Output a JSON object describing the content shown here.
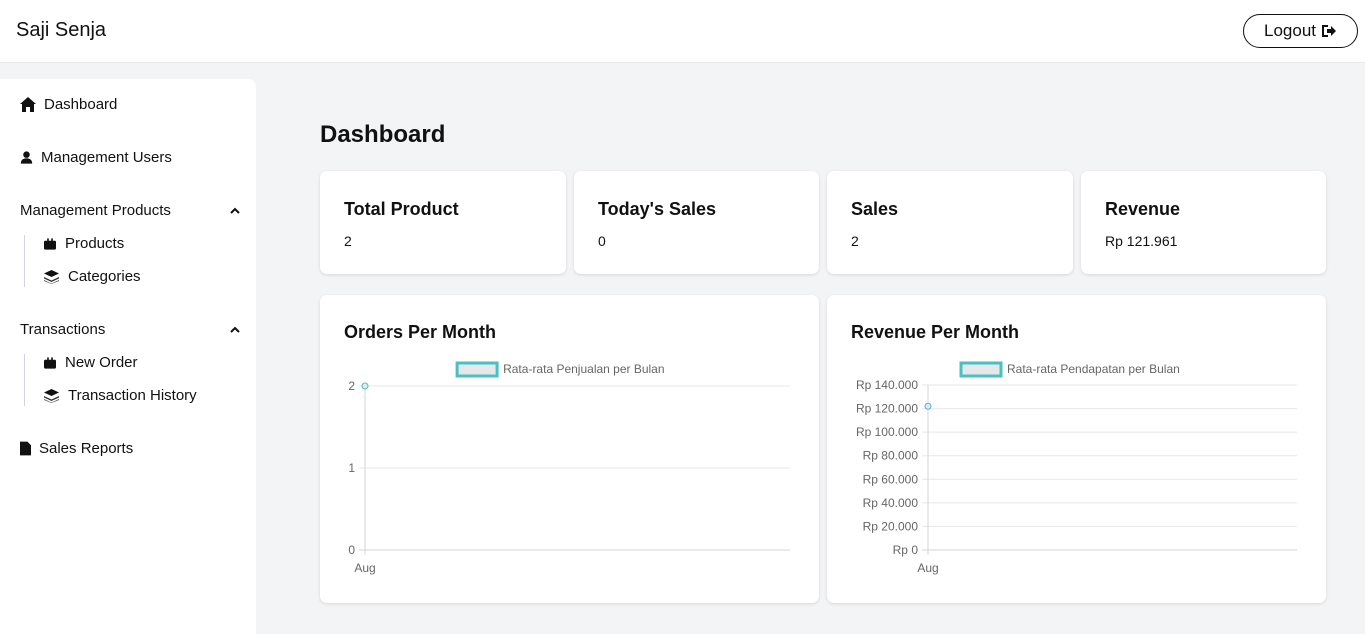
{
  "header": {
    "brand": "Saji Senja",
    "logout_label": "Logout"
  },
  "sidebar": {
    "dashboard": "Dashboard",
    "management_users": "Management Users",
    "management_products": {
      "label": "Management Products",
      "items": [
        "Products",
        "Categories"
      ]
    },
    "transactions": {
      "label": "Transactions",
      "items": [
        "New Order",
        "Transaction History"
      ]
    },
    "sales_reports": "Sales Reports"
  },
  "main": {
    "title": "Dashboard",
    "stats": [
      {
        "title": "Total Product",
        "value": "2"
      },
      {
        "title": "Today's Sales",
        "value": "0"
      },
      {
        "title": "Sales",
        "value": "2"
      },
      {
        "title": "Revenue",
        "value": "Rp 121.961"
      }
    ]
  },
  "colors": {
    "series": "#4bc0c0",
    "series_fill": "#e5e7eb",
    "grid": "#e5e7eb"
  },
  "chart_data": [
    {
      "type": "line",
      "title": "Orders Per Month",
      "categories": [
        "Aug"
      ],
      "series": [
        {
          "name": "Rata-rata Penjualan per Bulan",
          "values": [
            2
          ]
        }
      ],
      "ylim": [
        0,
        2
      ],
      "yticks": [
        0,
        1,
        2
      ],
      "ytick_labels": [
        "0",
        "1",
        "2"
      ],
      "legend": "top",
      "grid": true
    },
    {
      "type": "line",
      "title": "Revenue Per Month",
      "categories": [
        "Aug"
      ],
      "series": [
        {
          "name": "Rata-rata Pendapatan per Bulan",
          "values": [
            121961
          ]
        }
      ],
      "ylim": [
        0,
        140000
      ],
      "yticks": [
        0,
        20000,
        40000,
        60000,
        80000,
        100000,
        120000,
        140000
      ],
      "ytick_labels": [
        "Rp 0",
        "Rp 20.000",
        "Rp 40.000",
        "Rp 60.000",
        "Rp 80.000",
        "Rp 100.000",
        "Rp 120.000",
        "Rp 140.000"
      ],
      "legend": "top",
      "grid": true
    }
  ]
}
